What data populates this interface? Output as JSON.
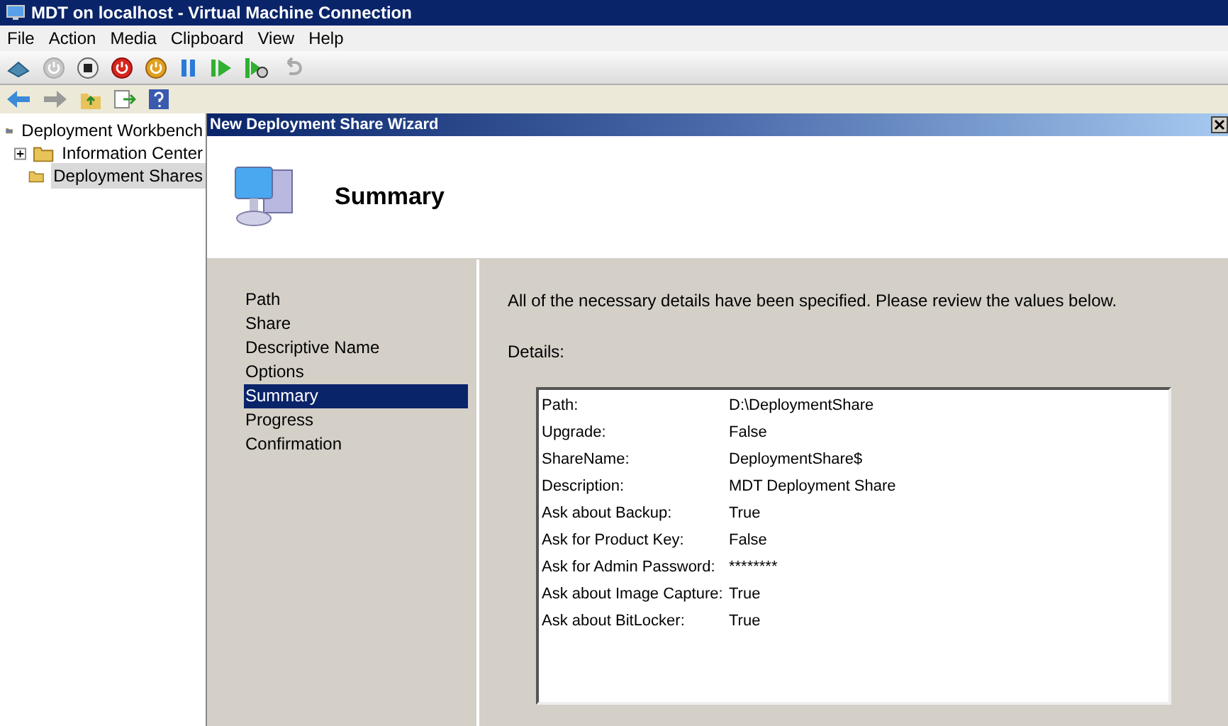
{
  "window": {
    "title": "MDT on localhost - Virtual Machine Connection"
  },
  "menu": [
    "File",
    "Action",
    "Media",
    "Clipboard",
    "View",
    "Help"
  ],
  "tree": [
    {
      "label": "Deployment Workbench",
      "selected": false,
      "children": [
        {
          "label": "Information Center",
          "selected": false,
          "expanded": false
        },
        {
          "label": "Deployment Shares",
          "selected": true
        }
      ]
    }
  ],
  "wizard": {
    "title": "New Deployment Share Wizard",
    "heading": "Summary",
    "steps": [
      {
        "label": "Path",
        "selected": false
      },
      {
        "label": "Share",
        "selected": false
      },
      {
        "label": "Descriptive Name",
        "selected": false
      },
      {
        "label": "Options",
        "selected": false
      },
      {
        "label": "Summary",
        "selected": true
      },
      {
        "label": "Progress",
        "selected": false
      },
      {
        "label": "Confirmation",
        "selected": false
      }
    ],
    "intro": "All of the necessary details have been specified.  Please review the values below.",
    "details_label": "Details:",
    "details": [
      {
        "name": "Path:",
        "value": "D:\\DeploymentShare"
      },
      {
        "name": "Upgrade:",
        "value": "False"
      },
      {
        "name": "ShareName:",
        "value": "DeploymentShare$"
      },
      {
        "name": "Description:",
        "value": "MDT Deployment Share"
      },
      {
        "name": "Ask about Backup:",
        "value": "True"
      },
      {
        "name": "Ask for Product Key:",
        "value": "False"
      },
      {
        "name": "Ask for Admin Password:",
        "value": "********"
      },
      {
        "name": "Ask about Image Capture:",
        "value": "True"
      },
      {
        "name": "Ask about BitLocker:",
        "value": "True"
      }
    ]
  }
}
